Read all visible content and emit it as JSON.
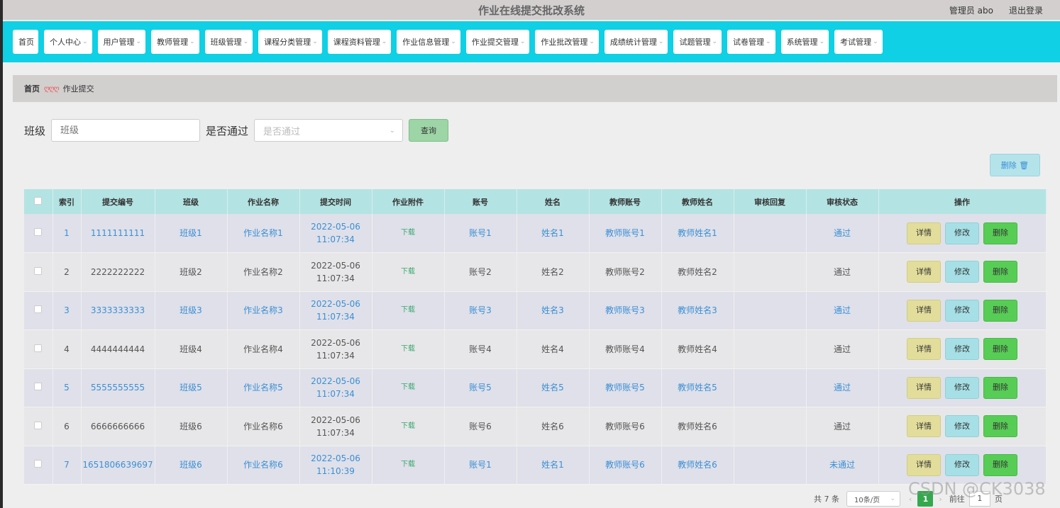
{
  "header": {
    "title": "作业在线提交批改系统",
    "admin": "管理员 abo",
    "logout": "退出登录"
  },
  "nav": [
    "首页",
    "个人中心",
    "用户管理",
    "教师管理",
    "班级管理",
    "课程分类管理",
    "课程资料管理",
    "作业信息管理",
    "作业提交管理",
    "作业批改管理",
    "成绩统计管理",
    "试题管理",
    "试卷管理",
    "系统管理",
    "考试管理"
  ],
  "breadcrumb": {
    "home": "首页",
    "sep": "ღღღ",
    "current": "作业提交"
  },
  "search": {
    "class_label": "班级",
    "class_placeholder": "班级",
    "pass_label": "是否通过",
    "pass_placeholder": "是否通过",
    "query_button": "查询"
  },
  "batch_delete": "删除 🗑",
  "table": {
    "headers": [
      "索引",
      "提交编号",
      "班级",
      "作业名称",
      "提交时间",
      "作业附件",
      "账号",
      "姓名",
      "教师账号",
      "教师姓名",
      "审核回复",
      "审核状态",
      "操作"
    ],
    "rows": [
      {
        "index": "1",
        "code": "1111111111",
        "cls": "班级1",
        "name": "作业名称1",
        "time": "2022-05-06 11:07:34",
        "file": "下载",
        "account": "账号1",
        "student": "姓名1",
        "t_account": "教师账号1",
        "t_name": "教师姓名1",
        "reply": "",
        "status": "通过"
      },
      {
        "index": "2",
        "code": "2222222222",
        "cls": "班级2",
        "name": "作业名称2",
        "time": "2022-05-06 11:07:34",
        "file": "下载",
        "account": "账号2",
        "student": "姓名2",
        "t_account": "教师账号2",
        "t_name": "教师姓名2",
        "reply": "",
        "status": "通过"
      },
      {
        "index": "3",
        "code": "3333333333",
        "cls": "班级3",
        "name": "作业名称3",
        "time": "2022-05-06 11:07:34",
        "file": "下载",
        "account": "账号3",
        "student": "姓名3",
        "t_account": "教师账号3",
        "t_name": "教师姓名3",
        "reply": "",
        "status": "通过"
      },
      {
        "index": "4",
        "code": "4444444444",
        "cls": "班级4",
        "name": "作业名称4",
        "time": "2022-05-06 11:07:34",
        "file": "下载",
        "account": "账号4",
        "student": "姓名4",
        "t_account": "教师账号4",
        "t_name": "教师姓名4",
        "reply": "",
        "status": "通过"
      },
      {
        "index": "5",
        "code": "5555555555",
        "cls": "班级5",
        "name": "作业名称5",
        "time": "2022-05-06 11:07:34",
        "file": "下载",
        "account": "账号5",
        "student": "姓名5",
        "t_account": "教师账号5",
        "t_name": "教师姓名5",
        "reply": "",
        "status": "通过"
      },
      {
        "index": "6",
        "code": "6666666666",
        "cls": "班级6",
        "name": "作业名称6",
        "time": "2022-05-06 11:07:34",
        "file": "下载",
        "account": "账号6",
        "student": "姓名6",
        "t_account": "教师账号6",
        "t_name": "教师姓名6",
        "reply": "",
        "status": "通过"
      },
      {
        "index": "7",
        "code": "1651806639697",
        "cls": "班级6",
        "name": "作业名称6",
        "time": "2022-05-06 11:10:39",
        "file": "下载",
        "account": "账号1",
        "student": "姓名1",
        "t_account": "教师账号6",
        "t_name": "教师姓名6",
        "reply": "",
        "status": "未通过"
      }
    ],
    "actions": {
      "detail": "详情",
      "edit": "修改",
      "delete": "删除"
    }
  },
  "pagination": {
    "total": "共 7 条",
    "page_size": "10条/页",
    "prev": "‹",
    "current_page": "1",
    "next": "›",
    "goto": "前往",
    "goto_value": "1",
    "page_unit": "页"
  },
  "watermark": "CSDN @CK3038"
}
